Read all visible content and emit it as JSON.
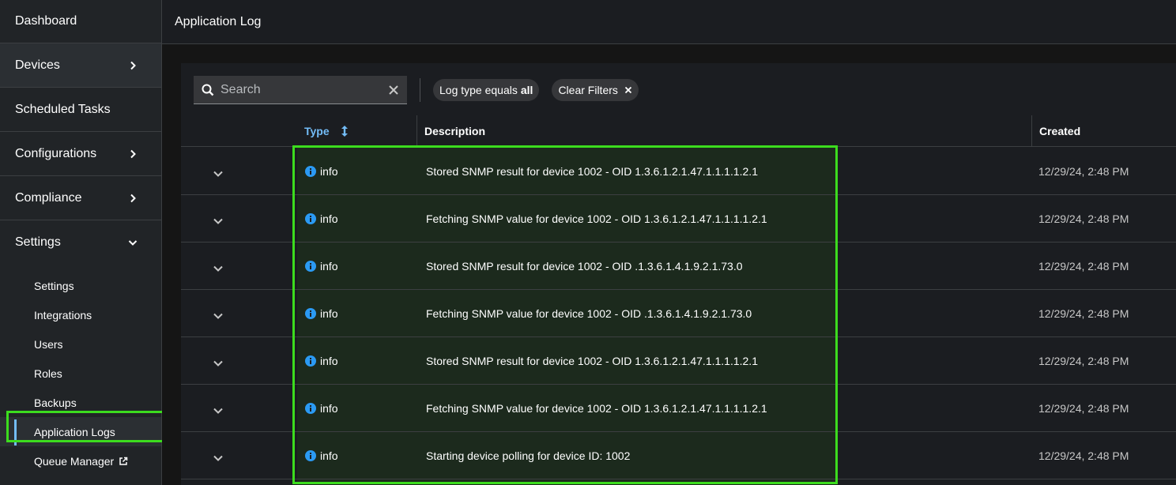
{
  "sidebar": {
    "items": [
      {
        "label": "Dashboard",
        "has_chevron": false
      },
      {
        "label": "Devices",
        "has_chevron": true
      },
      {
        "label": "Scheduled Tasks",
        "has_chevron": false
      },
      {
        "label": "Configurations",
        "has_chevron": true
      },
      {
        "label": "Compliance",
        "has_chevron": true
      },
      {
        "label": "Settings",
        "has_chevron": true,
        "expanded": true
      }
    ],
    "sub_items": [
      {
        "label": "Settings"
      },
      {
        "label": "Integrations"
      },
      {
        "label": "Users"
      },
      {
        "label": "Roles"
      },
      {
        "label": "Backups"
      },
      {
        "label": "Application Logs",
        "current": true
      },
      {
        "label": "Queue Manager",
        "external": true
      }
    ]
  },
  "header": {
    "title": "Application Log"
  },
  "toolbar": {
    "search_placeholder": "Search",
    "filter_chip_prefix": "Log type equals",
    "filter_chip_value": "all",
    "clear_filters_label": "Clear Filters"
  },
  "table": {
    "columns": {
      "type": "Type",
      "description": "Description",
      "created": "Created"
    },
    "rows": [
      {
        "type": "info",
        "description": "Stored SNMP result for device 1002 - OID 1.3.6.1.2.1.47.1.1.1.1.2.1",
        "created": "12/29/24, 2:48 PM"
      },
      {
        "type": "info",
        "description": "Fetching SNMP value for device 1002 - OID 1.3.6.1.2.1.47.1.1.1.1.2.1",
        "created": "12/29/24, 2:48 PM"
      },
      {
        "type": "info",
        "description": "Stored SNMP result for device 1002 - OID .1.3.6.1.4.1.9.2.1.73.0",
        "created": "12/29/24, 2:48 PM"
      },
      {
        "type": "info",
        "description": "Fetching SNMP value for device 1002 - OID .1.3.6.1.4.1.9.2.1.73.0",
        "created": "12/29/24, 2:48 PM"
      },
      {
        "type": "info",
        "description": "Stored SNMP result for device 1002 - OID 1.3.6.1.2.1.47.1.1.1.1.2.1",
        "created": "12/29/24, 2:48 PM"
      },
      {
        "type": "info",
        "description": "Fetching SNMP value for device 1002 - OID 1.3.6.1.2.1.47.1.1.1.1.2.1",
        "created": "12/29/24, 2:48 PM"
      },
      {
        "type": "info",
        "description": "Starting device polling for device ID: 1002",
        "created": "12/29/24, 2:48 PM"
      }
    ]
  },
  "colors": {
    "accent": "#73bcf7",
    "highlight": "#3cdc1e",
    "info_icon": "#2b9af3"
  },
  "icons": {
    "search": "search-icon",
    "clear": "close-icon",
    "sort": "sort-icon",
    "expand": "chevron-down-icon",
    "info": "info-circle-icon",
    "external": "external-link-icon"
  }
}
